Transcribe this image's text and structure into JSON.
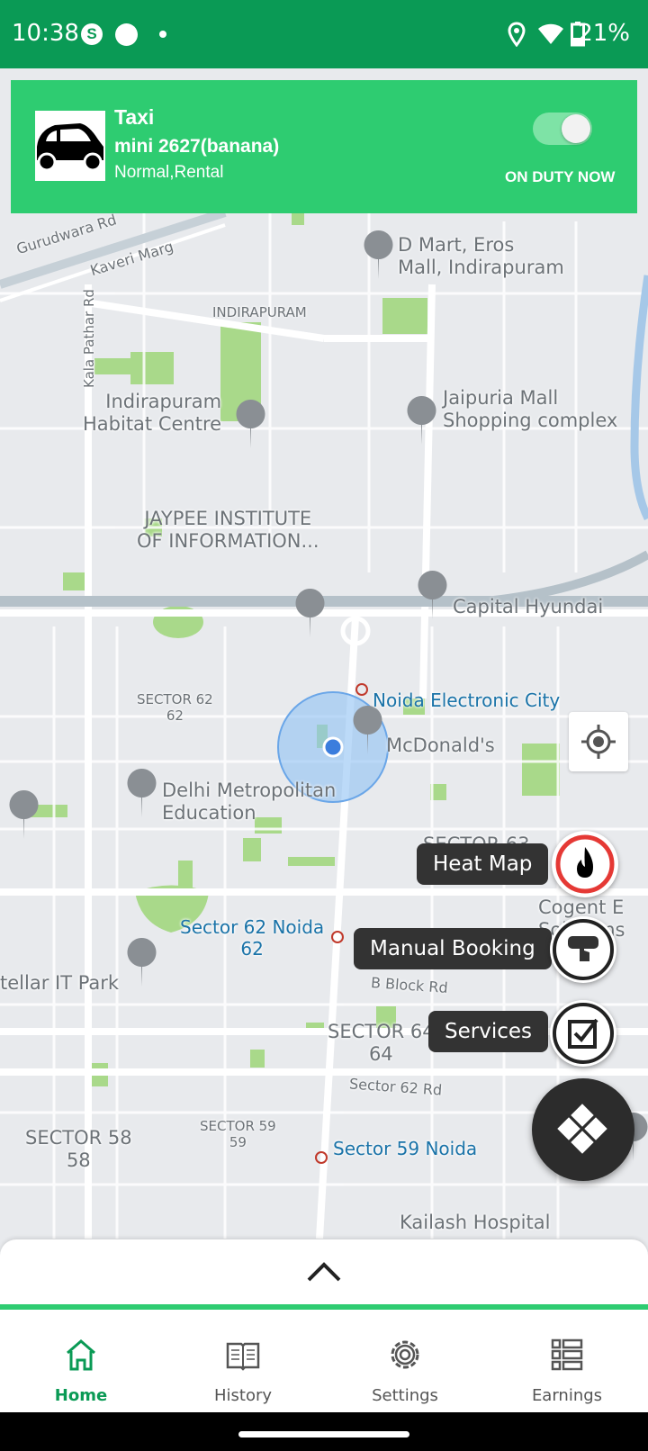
{
  "status_bar": {
    "time": "10:38",
    "battery": "21%",
    "icons": [
      "skype-icon",
      "circle-icon",
      "dot-icon",
      "location-icon",
      "wifi-icon",
      "battery-icon"
    ]
  },
  "vehicle": {
    "type": "Taxi",
    "name": "mini 2627(banana)",
    "modes": "Normal,Rental",
    "duty_status": "ON DUTY NOW",
    "duty_on": true
  },
  "map": {
    "labels": {
      "gurudwara": "Gurudwara Rd",
      "kaveri": "Kaveri Marg",
      "kala": "Kala Pathar Rd",
      "indirapuram": "INDIRAPURAM",
      "dmart": "D Mart, Eros\nMall, Indirapuram",
      "habitat": "Indirapuram\nHabitat Centre",
      "jaipuria": "Jaipuria Mall\nShopping complex",
      "jaypee": "JAYPEE INSTITUTE\nOF INFORMATION...",
      "hyundai": "Capital Hyundai",
      "sector62": "SECTOR 62\n62",
      "noida_ec": "Noida Electronic City",
      "mcd": "McDonald's",
      "delhi_met": "Delhi Metropolitan\nEducation",
      "sector63": "SECTOR 63",
      "cogent": "Cogent E\nSolutions Lim",
      "sector62_noida": "Sector 62 Noida\n62",
      "stellar": "tellar IT Park",
      "bblock": "B Block Rd",
      "sector64": "SECTOR 64\n64",
      "sector62rd": "Sector 62 Rd",
      "sector58": "SECTOR 58\n58",
      "sector59": "SECTOR 59\n59",
      "sector59_noida": "Sector 59 Noida",
      "kailash": "Kailash Hospital"
    }
  },
  "fabs": {
    "heat_map": "Heat Map",
    "manual_booking": "Manual Booking",
    "services": "Services"
  },
  "nav": {
    "home": "Home",
    "history": "History",
    "settings": "Settings",
    "earnings": "Earnings"
  },
  "colors": {
    "brand": "#2ecc71",
    "status_bar": "#0a9a55",
    "heat_ring": "#e53935"
  }
}
